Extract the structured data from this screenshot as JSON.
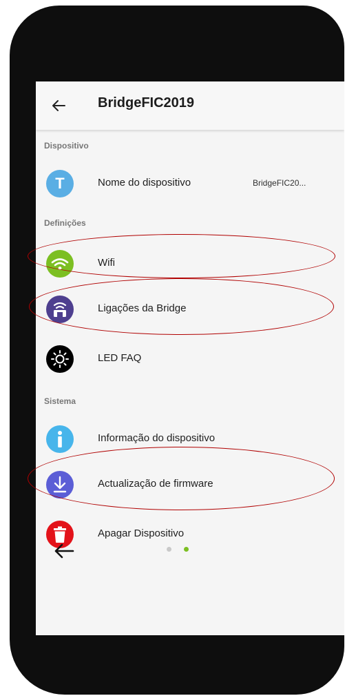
{
  "header": {
    "title": "BridgeFIC2019"
  },
  "sections": {
    "device": "Dispositivo",
    "settings": "Definições",
    "system": "Sistema"
  },
  "rows": {
    "device_name": {
      "label": "Nome do dispositivo",
      "value": "BridgeFIC20...",
      "icon": "T",
      "icon_name": "text-icon",
      "color": "#5aaee4"
    },
    "wifi": {
      "label": "Wifi",
      "icon_name": "wifi-icon",
      "color": "#7cbf22"
    },
    "bridge_links": {
      "label": "Ligações da Bridge",
      "icon_name": "bridge-router-icon",
      "color": "#4e3f8f"
    },
    "led_faq": {
      "label": "LED FAQ",
      "icon_name": "led-sun-icon",
      "color": "#000000"
    },
    "device_info": {
      "label": "Informação do dispositivo",
      "icon": "i",
      "icon_name": "info-icon",
      "color": "#47b5eb"
    },
    "firmware_update": {
      "label": "Actualização de firmware",
      "icon_name": "download-icon",
      "color": "#5b5ed6"
    },
    "delete_device": {
      "label": "Apagar Dispositivo",
      "icon_name": "trash-icon",
      "color": "#e3131a"
    }
  },
  "pager": {
    "pages": 2,
    "active_page": 2,
    "active_color": "#7cbf22",
    "inactive_color": "#c9c9c9"
  },
  "annotation_color": "#b00000"
}
